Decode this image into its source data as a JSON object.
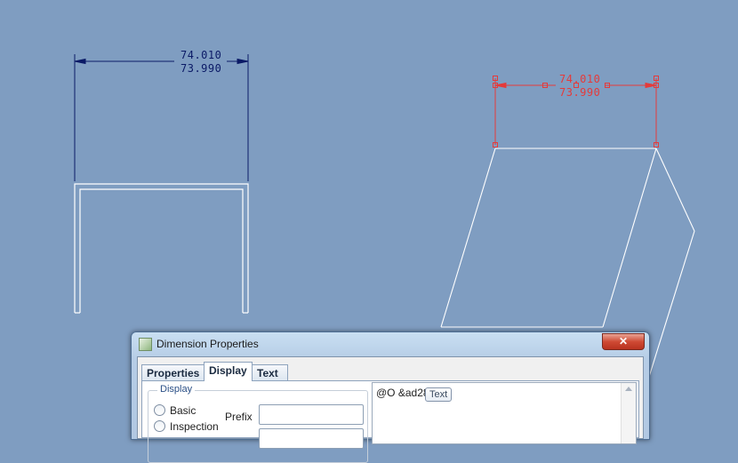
{
  "drawing": {
    "front_view_dim": {
      "upper": "74.010",
      "lower": "73.990"
    },
    "iso_view_dim": {
      "upper": "74.010",
      "lower": "73.990"
    }
  },
  "dialog": {
    "title": "Dimension Properties",
    "close_glyph": "✕",
    "tabs": [
      {
        "label": "Properties"
      },
      {
        "label": "Display"
      },
      {
        "label": "Text Style"
      }
    ],
    "active_tab": "Display",
    "tooltip": "Text",
    "display_group": {
      "label": "Display",
      "radios": [
        {
          "label": "Basic",
          "checked": false
        },
        {
          "label": "Inspection",
          "checked": false
        }
      ],
      "prefix_label": "Prefix",
      "prefix_value": ""
    },
    "text_value": "@O &ad28"
  },
  "colors": {
    "background": "#7f9dc1",
    "dimension_dark": "#0b1a66",
    "dimension_selected": "#e53a3a",
    "geometry": "#ffffff"
  }
}
